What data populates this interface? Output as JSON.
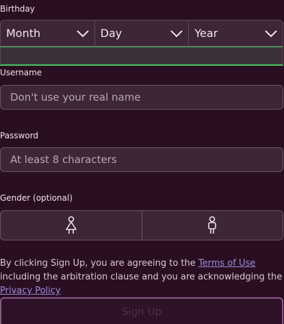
{
  "birthday": {
    "label": "Birthday",
    "month": "Month",
    "day": "Day",
    "year": "Year"
  },
  "username": {
    "label": "Username",
    "placeholder": "Don't use your real name"
  },
  "password": {
    "label": "Password",
    "placeholder": "At least 8 characters"
  },
  "gender": {
    "label": "Gender (optional)",
    "options": [
      "female-icon",
      "male-icon"
    ]
  },
  "terms": {
    "prefix": "By clicking Sign Up, you are agreeing to the ",
    "terms_link": "Terms of Use",
    "middle": " including the arbitration clause and you are acknowledging the ",
    "privacy_link": "Privacy Policy"
  },
  "signup": {
    "label": "Sign Up"
  },
  "colors": {
    "background": "#2a0f22",
    "success_border": "#46c863",
    "link": "#9a8fe0"
  }
}
